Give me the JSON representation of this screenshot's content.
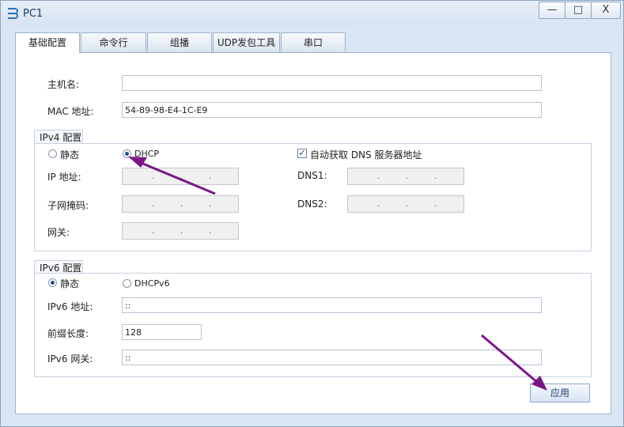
{
  "window": {
    "title": "PC1",
    "minimize_glyph": "—",
    "maximize_glyph": "□",
    "close_glyph": "X"
  },
  "tabs": [
    {
      "label": "基础配置",
      "active": true
    },
    {
      "label": "命令行",
      "active": false
    },
    {
      "label": "组播",
      "active": false
    },
    {
      "label": "UDP发包工具",
      "active": false
    },
    {
      "label": "串口",
      "active": false
    }
  ],
  "basic": {
    "hostname_label": "主机名:",
    "hostname_value": "",
    "mac_label": "MAC 地址:",
    "mac_value": "54-89-98-E4-1C-E9"
  },
  "ipv4": {
    "title": "IPv4 配置",
    "static_label": "静态",
    "dhcp_label": "DHCP",
    "mode": "DHCP",
    "auto_dns_label": "自动获取 DNS 服务器地址",
    "auto_dns_checked": true,
    "ip_label": "IP 地址:",
    "mask_label": "子网掩码:",
    "gateway_label": "网关:",
    "dns1_label": "DNS1:",
    "dns2_label": "DNS2:",
    "ip_dot": "."
  },
  "ipv6": {
    "title": "IPv6 配置",
    "static_label": "静态",
    "dhcpv6_label": "DHCPv6",
    "mode": "静态",
    "addr_label": "IPv6 地址:",
    "addr_value": "::",
    "prefix_label": "前缀长度:",
    "prefix_value": "128",
    "gateway_label": "IPv6 网关:",
    "gateway_value": "::"
  },
  "apply_button": "应用",
  "colors": {
    "annotation_arrow": "#7a1688",
    "accent": "#1f4f8b"
  }
}
